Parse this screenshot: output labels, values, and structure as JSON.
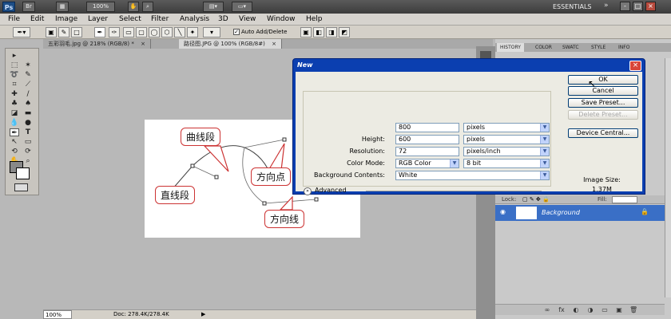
{
  "appbar": {
    "logo": "Ps",
    "zoom_display": "100%",
    "workspace": "ESSENTIALS",
    "window_controls": [
      "-",
      "□",
      "×"
    ]
  },
  "menubar": {
    "items": [
      "File",
      "Edit",
      "Image",
      "Layer",
      "Select",
      "Filter",
      "Analysis",
      "3D",
      "View",
      "Window",
      "Help"
    ]
  },
  "options": {
    "auto_add_delete": "Auto Add/Delete",
    "auto_add_checked": true
  },
  "doc_tabs": [
    {
      "label": "五彩羽毛.jpg @ 218% (RGB/8) *",
      "active": false,
      "close": "×"
    },
    {
      "label": "路径图.JPG @ 100% (RGB/8#)",
      "active": true,
      "close": "×"
    }
  ],
  "canvas": {
    "callouts": [
      "曲线段",
      "方向点",
      "直线段",
      "方向线"
    ]
  },
  "statusbar": {
    "zoom": "100%",
    "doc_size": "Doc: 278.4K/278.4K",
    "arrow": "▶"
  },
  "panels": {
    "tabs": [
      "HISTORY",
      "COLOR",
      "SWATC",
      "STYLE",
      "INFO"
    ],
    "lock_label": "Lock:",
    "fill_label": "Fill:",
    "layer_name": "Background"
  },
  "dialog": {
    "title": "New",
    "close": "×",
    "fields": [
      {
        "label": "",
        "value": "800",
        "unit": "pixels"
      },
      {
        "label": "Height:",
        "value": "600",
        "unit": "pixels"
      },
      {
        "label": "Resolution:",
        "value": "72",
        "unit": "pixels/inch"
      },
      {
        "label": "Color Mode:",
        "value": "RGB Color",
        "unit": "8 bit"
      },
      {
        "label": "Background Contents:",
        "value": "White",
        "unit": ""
      }
    ],
    "advanced_label": "Advanced",
    "buttons": {
      "ok": "OK",
      "cancel": "Cancel",
      "save_preset": "Save Preset...",
      "delete_preset": "Delete Preset...",
      "device_central": "Device Central..."
    },
    "image_size_label": "Image Size:",
    "image_size_value": "1.37M"
  },
  "colors": {
    "dialog_title_bg": "#0b3fb0",
    "dialog_body_bg": "#ecebe3",
    "layer_selected": "#3a6fc6",
    "callout_border": "#cc3333"
  },
  "icons": [
    "photoshop-logo",
    "move-icon",
    "marquee-icon",
    "lasso-icon",
    "crop-icon",
    "brush-icon",
    "pen-icon",
    "type-icon",
    "hand-icon",
    "zoom-icon",
    "eye-icon",
    "lock-icon",
    "close-icon",
    "chevron-down-icon",
    "cursor-icon"
  ]
}
